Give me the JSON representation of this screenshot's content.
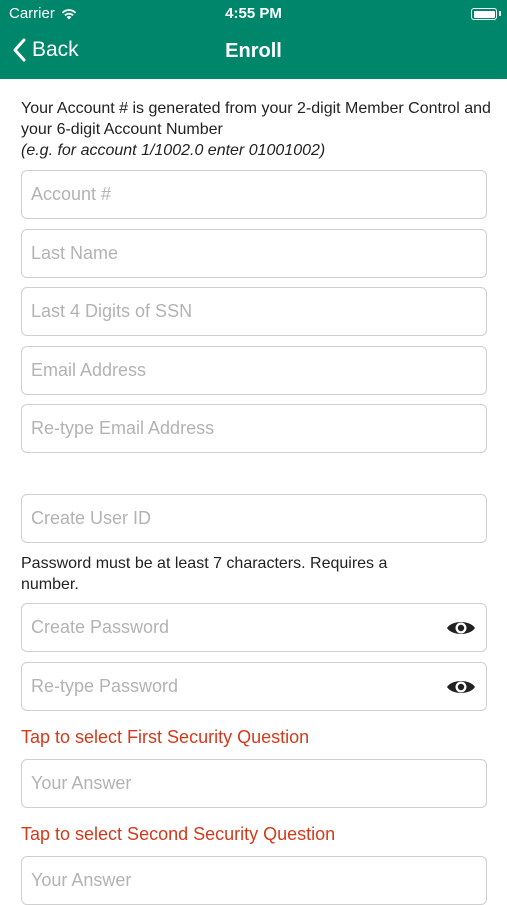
{
  "status_bar": {
    "carrier": "Carrier",
    "time": "4:55 PM"
  },
  "nav": {
    "back_label": "Back",
    "title": "Enroll"
  },
  "intro": {
    "line": "Your Account # is generated from your 2-digit Member Control and your 6-digit Account Number",
    "example": "(e.g. for account 1/1002.0 enter 01001002)"
  },
  "fields": {
    "account": "Account #",
    "last_name": "Last Name",
    "ssn": "Last 4 Digits of SSN",
    "email": "Email Address",
    "email_confirm": "Re-type Email Address",
    "user_id": "Create User ID",
    "password": "Create Password",
    "password_confirm": "Re-type Password",
    "answer1": "Your Answer",
    "answer2": "Your Answer"
  },
  "password_hint": "Password must be at least 7 characters. Requires a number.",
  "security": {
    "first_question": "Tap to select First Security Question",
    "second_question": "Tap to select Second Security Question"
  },
  "colors": {
    "header": "#00876b",
    "link": "#d33a1c",
    "field_border": "#cfcfcf"
  },
  "icons": {
    "back": "chevron-left-icon",
    "show_password": "eye-icon",
    "wifi": "wifi-icon",
    "battery": "battery-icon"
  }
}
